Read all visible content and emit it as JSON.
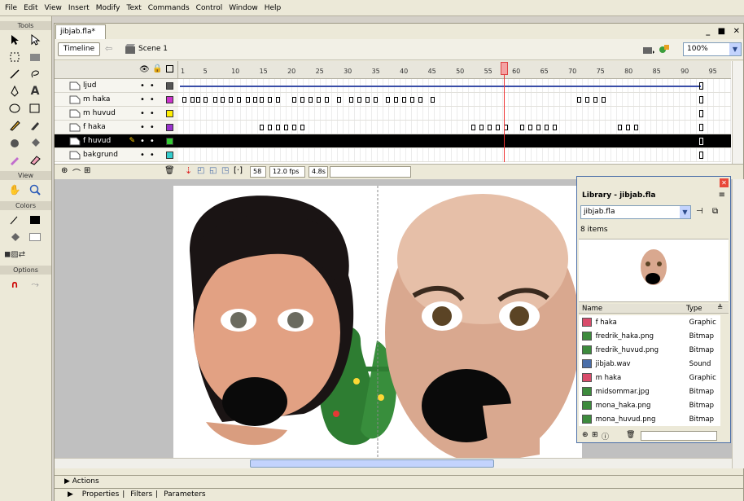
{
  "menu": [
    "File",
    "Edit",
    "View",
    "Insert",
    "Modify",
    "Text",
    "Commands",
    "Control",
    "Window",
    "Help"
  ],
  "tools": {
    "label": "Tools",
    "view_label": "View",
    "colors_label": "Colors",
    "options_label": "Options"
  },
  "document": {
    "tab": "jibjab.fla*",
    "window_controls": "_ ■ ✕",
    "timeline_button": "Timeline",
    "scene": "Scene 1",
    "zoom": "100%"
  },
  "timeline": {
    "ruler": [
      "1",
      "5",
      "10",
      "15",
      "20",
      "25",
      "30",
      "35",
      "40",
      "45",
      "50",
      "55",
      "60",
      "65",
      "70",
      "75",
      "80",
      "85",
      "90",
      "95"
    ],
    "layers": [
      {
        "name": "ljud",
        "color": "#555555",
        "selected": false
      },
      {
        "name": "m haka",
        "color": "#cc33cc",
        "selected": false
      },
      {
        "name": "m huvud",
        "color": "#ffee00",
        "selected": false
      },
      {
        "name": "f haka",
        "color": "#9933cc",
        "selected": false
      },
      {
        "name": "f huvud",
        "color": "#33cc33",
        "selected": true
      },
      {
        "name": "bakgrund",
        "color": "#33cccc",
        "selected": false
      }
    ],
    "current_frame": "58",
    "fps": "12.0 fps",
    "time": "4.8s"
  },
  "library": {
    "title": "Library - jibjab.fla",
    "file": "jibjab.fla",
    "count": "8 items",
    "col_name": "Name",
    "col_type": "Type",
    "items": [
      {
        "name": "f haka",
        "type": "Graphic",
        "icon": "graphic"
      },
      {
        "name": "fredrik_haka.png",
        "type": "Bitmap",
        "icon": "bitmap"
      },
      {
        "name": "fredrik_huvud.png",
        "type": "Bitmap",
        "icon": "bitmap"
      },
      {
        "name": "jibjab.wav",
        "type": "Sound",
        "icon": "sound"
      },
      {
        "name": "m haka",
        "type": "Graphic",
        "icon": "graphic"
      },
      {
        "name": "midsommar.jpg",
        "type": "Bitmap",
        "icon": "bitmap"
      },
      {
        "name": "mona_haka.png",
        "type": "Bitmap",
        "icon": "bitmap"
      },
      {
        "name": "mona_huvud.png",
        "type": "Bitmap",
        "icon": "bitmap"
      }
    ]
  },
  "panels": {
    "actions": "Actions",
    "properties": "Properties",
    "filters": "Filters",
    "parameters": "Parameters"
  }
}
